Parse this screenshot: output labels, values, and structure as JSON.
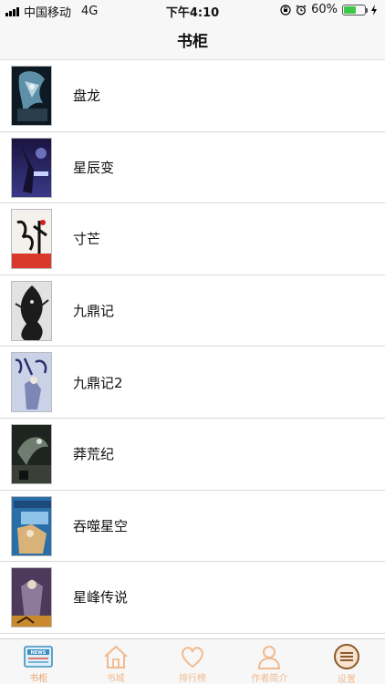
{
  "status_bar": {
    "carrier": "中国移动",
    "network": "4G",
    "time": "下午4:10",
    "battery_percent": "60%",
    "battery_level": 0.6
  },
  "nav": {
    "title": "书柜"
  },
  "books": [
    {
      "title": "盘龙"
    },
    {
      "title": "星辰变"
    },
    {
      "title": "寸芒"
    },
    {
      "title": "九鼎记"
    },
    {
      "title": "九鼎记2"
    },
    {
      "title": "莽荒纪"
    },
    {
      "title": "吞噬星空"
    },
    {
      "title": "星峰传说"
    }
  ],
  "tabs": [
    {
      "label": "书柜",
      "icon": "news-icon",
      "active": true
    },
    {
      "label": "书城",
      "icon": "house-icon"
    },
    {
      "label": "排行榜",
      "icon": "heart-icon"
    },
    {
      "label": "作者简介",
      "icon": "person-icon"
    },
    {
      "label": "设置",
      "icon": "menu-icon"
    }
  ],
  "colors": {
    "accent": "#f0ba8e",
    "battery": "#3ec847"
  }
}
